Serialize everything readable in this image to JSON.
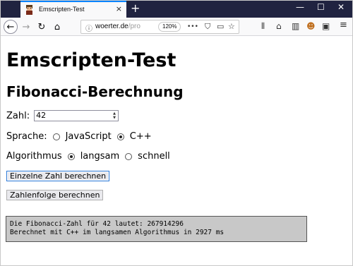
{
  "browser": {
    "tab_title": "Emscripten-Test",
    "tab_close": "×",
    "new_tab": "+",
    "controls": {
      "minimize": "—",
      "maximize": "☐",
      "close": "✕"
    },
    "url_host": "woerter.de",
    "url_path": "/pro",
    "zoom": "120%",
    "nav": {
      "back": "←",
      "forward": "→",
      "reload": "↻",
      "home": "⌂"
    },
    "url_actions": {
      "more": "•••",
      "pocket": "⛉",
      "reader": "▭",
      "bookmark": "☆"
    },
    "toolbar": {
      "library": "⫴",
      "synced": "⌂",
      "sidebar": "▥",
      "extension": "☻",
      "screenshot": "▣",
      "menu": "≡"
    }
  },
  "page": {
    "h1": "Emscripten-Test",
    "h2": "Fibonacci-Berechnung",
    "zahl_label": "Zahl:",
    "zahl_value": "42",
    "sprache_label": "Sprache:",
    "sprache_options": [
      "JavaScript",
      "C++"
    ],
    "sprache_selected": "C++",
    "algorithmus_label": "Algorithmus",
    "algorithmus_options": [
      "langsam",
      "schnell"
    ],
    "algorithmus_selected": "langsam",
    "btn_einzeln": "Einzelne Zahl berechnen",
    "btn_folge": "Zahlenfolge berechnen",
    "output_line1": "Die Fibonacci-Zahl für 42 lautet: 267914296",
    "output_line2": "Berechnet mit C++ im langsamen Algorithmus in 2927 ms"
  },
  "colors": {
    "tabstrip": "#202340",
    "tab_accent": "#0a84ff",
    "output_bg": "#c8c8c8"
  }
}
